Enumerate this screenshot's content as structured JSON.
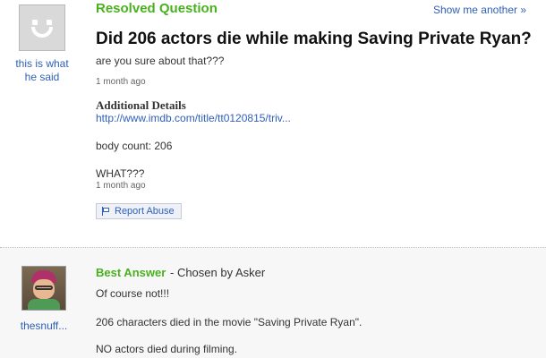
{
  "question": {
    "status": "Resolved Question",
    "show_another": "Show me another »",
    "title": "Did 206 actors die while making Saving Private Ryan?",
    "body": "are you sure about that???",
    "time": "1 month ago",
    "asker_name": "this is what he said",
    "additional_details": {
      "heading": "Additional Details",
      "link": "http://www.imdb.com/title/tt0120815/triv...",
      "body": "body count: 206",
      "what": "WHAT???",
      "time": "1 month ago"
    },
    "report_abuse": "Report Abuse"
  },
  "answer": {
    "label": "Best Answer",
    "chosen_by": "- Chosen by Asker",
    "answerer_name": "thesnuff...",
    "lines": [
      "Of course not!!!",
      "206 characters died in the movie \"Saving Private Ryan\".",
      "NO actors died during filming."
    ]
  },
  "colors": {
    "accent_green": "#4ab11e",
    "link_blue": "#3060b8",
    "answer_bg": "#f7f7f7"
  },
  "icons": [
    "default-avatar-icon",
    "flag-icon",
    "user-photo-avatar"
  ]
}
